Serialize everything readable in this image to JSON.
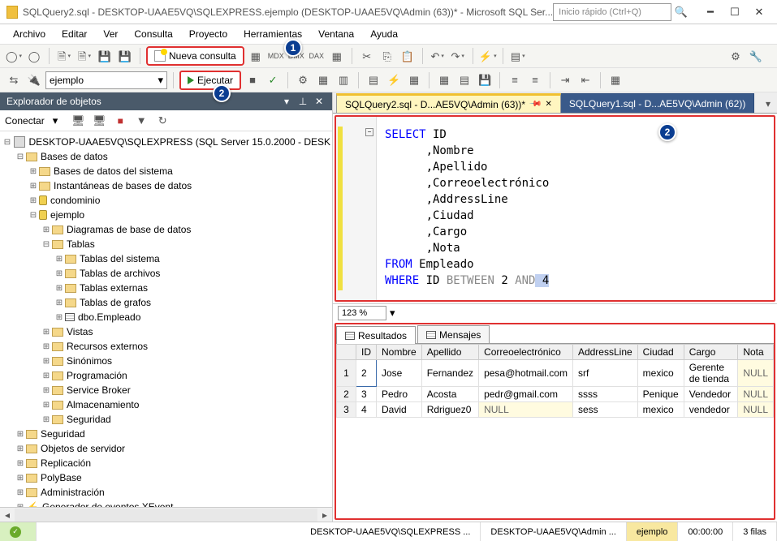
{
  "titlebar": {
    "title": "SQLQuery2.sql - DESKTOP-UAAE5VQ\\SQLEXPRESS.ejemplo (DESKTOP-UAAE5VQ\\Admin (63))* - Microsoft SQL Ser...",
    "quicklaunch_placeholder": "Inicio rápido (Ctrl+Q)"
  },
  "menu": {
    "items": [
      "Archivo",
      "Editar",
      "Ver",
      "Consulta",
      "Proyecto",
      "Herramientas",
      "Ventana",
      "Ayuda"
    ]
  },
  "toolbar": {
    "new_query": "Nueva consulta",
    "execute": "Ejecutar",
    "db_selected": "ejemplo"
  },
  "badges": {
    "b1": "1",
    "b2a": "2",
    "b2b": "2"
  },
  "objexplorer": {
    "title": "Explorador de objetos",
    "connect_label": "Conectar",
    "server": "DESKTOP-UAAE5VQ\\SQLEXPRESS (SQL Server 15.0.2000 - DESK",
    "nodes": {
      "bases_de_datos": "Bases de datos",
      "bd_sistema": "Bases de datos del sistema",
      "instantaneas": "Instantáneas de bases de datos",
      "condominio": "condominio",
      "ejemplo": "ejemplo",
      "diagramas": "Diagramas de base de datos",
      "tablas": "Tablas",
      "tablas_sistema": "Tablas del sistema",
      "tablas_archivos": "Tablas de archivos",
      "tablas_externas": "Tablas externas",
      "tablas_grafos": "Tablas de grafos",
      "dbo_empleado": "dbo.Empleado",
      "vistas": "Vistas",
      "recursos_externos": "Recursos externos",
      "sinonimos": "Sinónimos",
      "programacion": "Programación",
      "service_broker": "Service Broker",
      "almacenamiento": "Almacenamiento",
      "seguridad_db": "Seguridad",
      "seguridad": "Seguridad",
      "objetos_servidor": "Objetos de servidor",
      "replicacion": "Replicación",
      "polybase": "PolyBase",
      "administracion": "Administración",
      "xevent": "Generador de eventos XEvent"
    }
  },
  "tabs": {
    "t1": "SQLQuery2.sql - D...AE5VQ\\Admin (63))*",
    "t2": "SQLQuery1.sql - D...AE5VQ\\Admin (62))"
  },
  "code": {
    "l1a": "SELECT",
    "l1b": " ID",
    "l2": "      ,Nombre",
    "l3": "      ,Apellido",
    "l4": "      ,Correoelectrónico",
    "l5": "      ,AddressLine",
    "l6": "      ,Ciudad",
    "l7": "      ,Cargo",
    "l8": "      ,Nota",
    "l9a": "FROM",
    "l9b": " Empleado",
    "l10a": "WHERE",
    "l10b": " ID ",
    "l10c": "BETWEEN",
    "l10d": " 2 ",
    "l10e": "AND",
    "l10f": " 4"
  },
  "zoom": "123 %",
  "results": {
    "tab_results": "Resultados",
    "tab_messages": "Mensajes",
    "headers": [
      "",
      "ID",
      "Nombre",
      "Apellido",
      "Correoelectrónico",
      "AddressLine",
      "Ciudad",
      "Cargo",
      "Nota"
    ],
    "rows": [
      {
        "n": "1",
        "id": "2",
        "nombre": "Jose",
        "apellido": "Fernandez",
        "correo": "pesa@hotmail.com",
        "addr": "srf",
        "ciudad": "mexico",
        "cargo": "Gerente de tienda",
        "nota": "NULL"
      },
      {
        "n": "2",
        "id": "3",
        "nombre": "Pedro",
        "apellido": "Acosta",
        "correo": "pedr@gmail.com",
        "addr": "ssss",
        "ciudad": "Penique",
        "cargo": "Vendedor",
        "nota": "NULL"
      },
      {
        "n": "3",
        "id": "4",
        "nombre": "David",
        "apellido": "Rdriguez0",
        "correo": "NULL",
        "addr": "sess",
        "ciudad": "mexico",
        "cargo": "vendedor",
        "nota": "NULL"
      }
    ]
  },
  "statusbar": {
    "server": "DESKTOP-UAAE5VQ\\SQLEXPRESS ...",
    "user": "DESKTOP-UAAE5VQ\\Admin ...",
    "db": "ejemplo",
    "time": "00:00:00",
    "rows": "3 filas"
  }
}
